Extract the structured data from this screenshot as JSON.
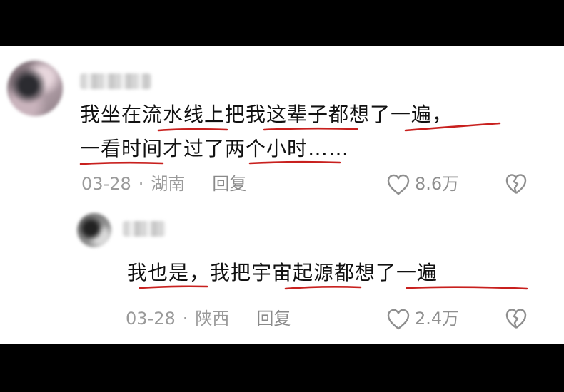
{
  "comments": [
    {
      "username": "b0y",
      "text_lines": [
        "我坐在流水线上把我这辈子都想了一遍，",
        "一看时间才过了两个小时……"
      ],
      "date": "03-28",
      "separator": "·",
      "location": "湖南",
      "reply_label": "回复",
      "likes": "8.6万",
      "like_icon": "heart-outline-icon",
      "dislike_icon": "broken-heart-icon"
    },
    {
      "username": "女生",
      "text_lines": [
        "我也是，我把宇宙起源都想了一遍"
      ],
      "date": "03-28",
      "separator": "·",
      "location": "陕西",
      "reply_label": "回复",
      "likes": "2.4万",
      "like_icon": "heart-outline-icon",
      "dislike_icon": "broken-heart-icon"
    }
  ],
  "colors": {
    "underline_ink": "#c8201e",
    "meta_text": "#9a9a9a",
    "body_text": "#111111",
    "background": "#ffffff",
    "letterbox": "#000000"
  }
}
